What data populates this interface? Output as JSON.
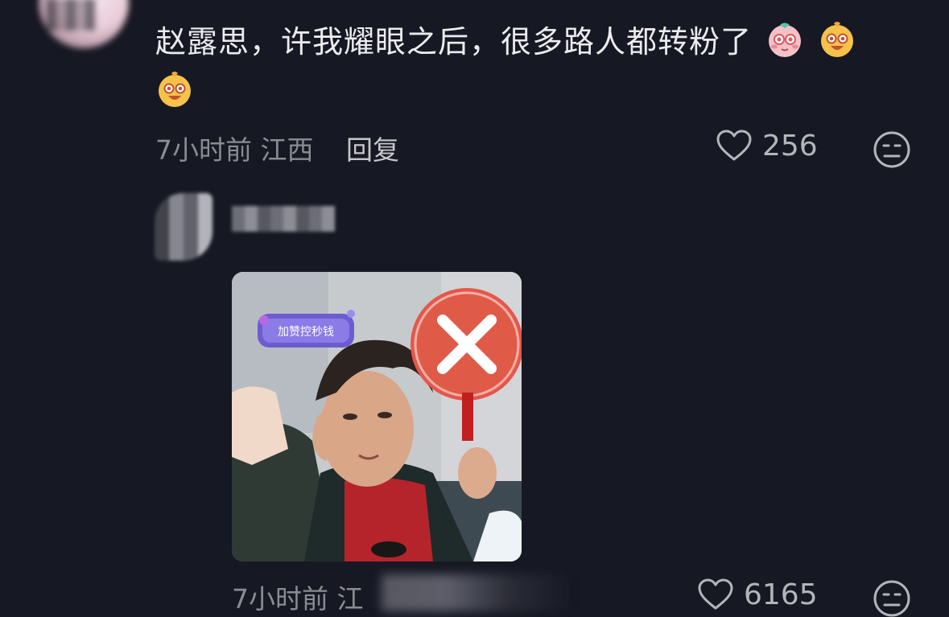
{
  "comment": {
    "text": "赵露思，许我耀眼之后，很多路人都转粉了",
    "emojis": [
      "shy-emoji",
      "smile-emoji",
      "smile-emoji"
    ],
    "time": "7小时前",
    "location": "江西",
    "reply_label": "回复",
    "likes": "256"
  },
  "reply": {
    "time": "7小时前",
    "location_partial": "江",
    "likes": "6165",
    "image_banner": "加赞控秒钱"
  },
  "colors": {
    "background": "#161823",
    "text": "#ececef",
    "meta": "#8b8c92",
    "no_sign": "#e4574a"
  }
}
